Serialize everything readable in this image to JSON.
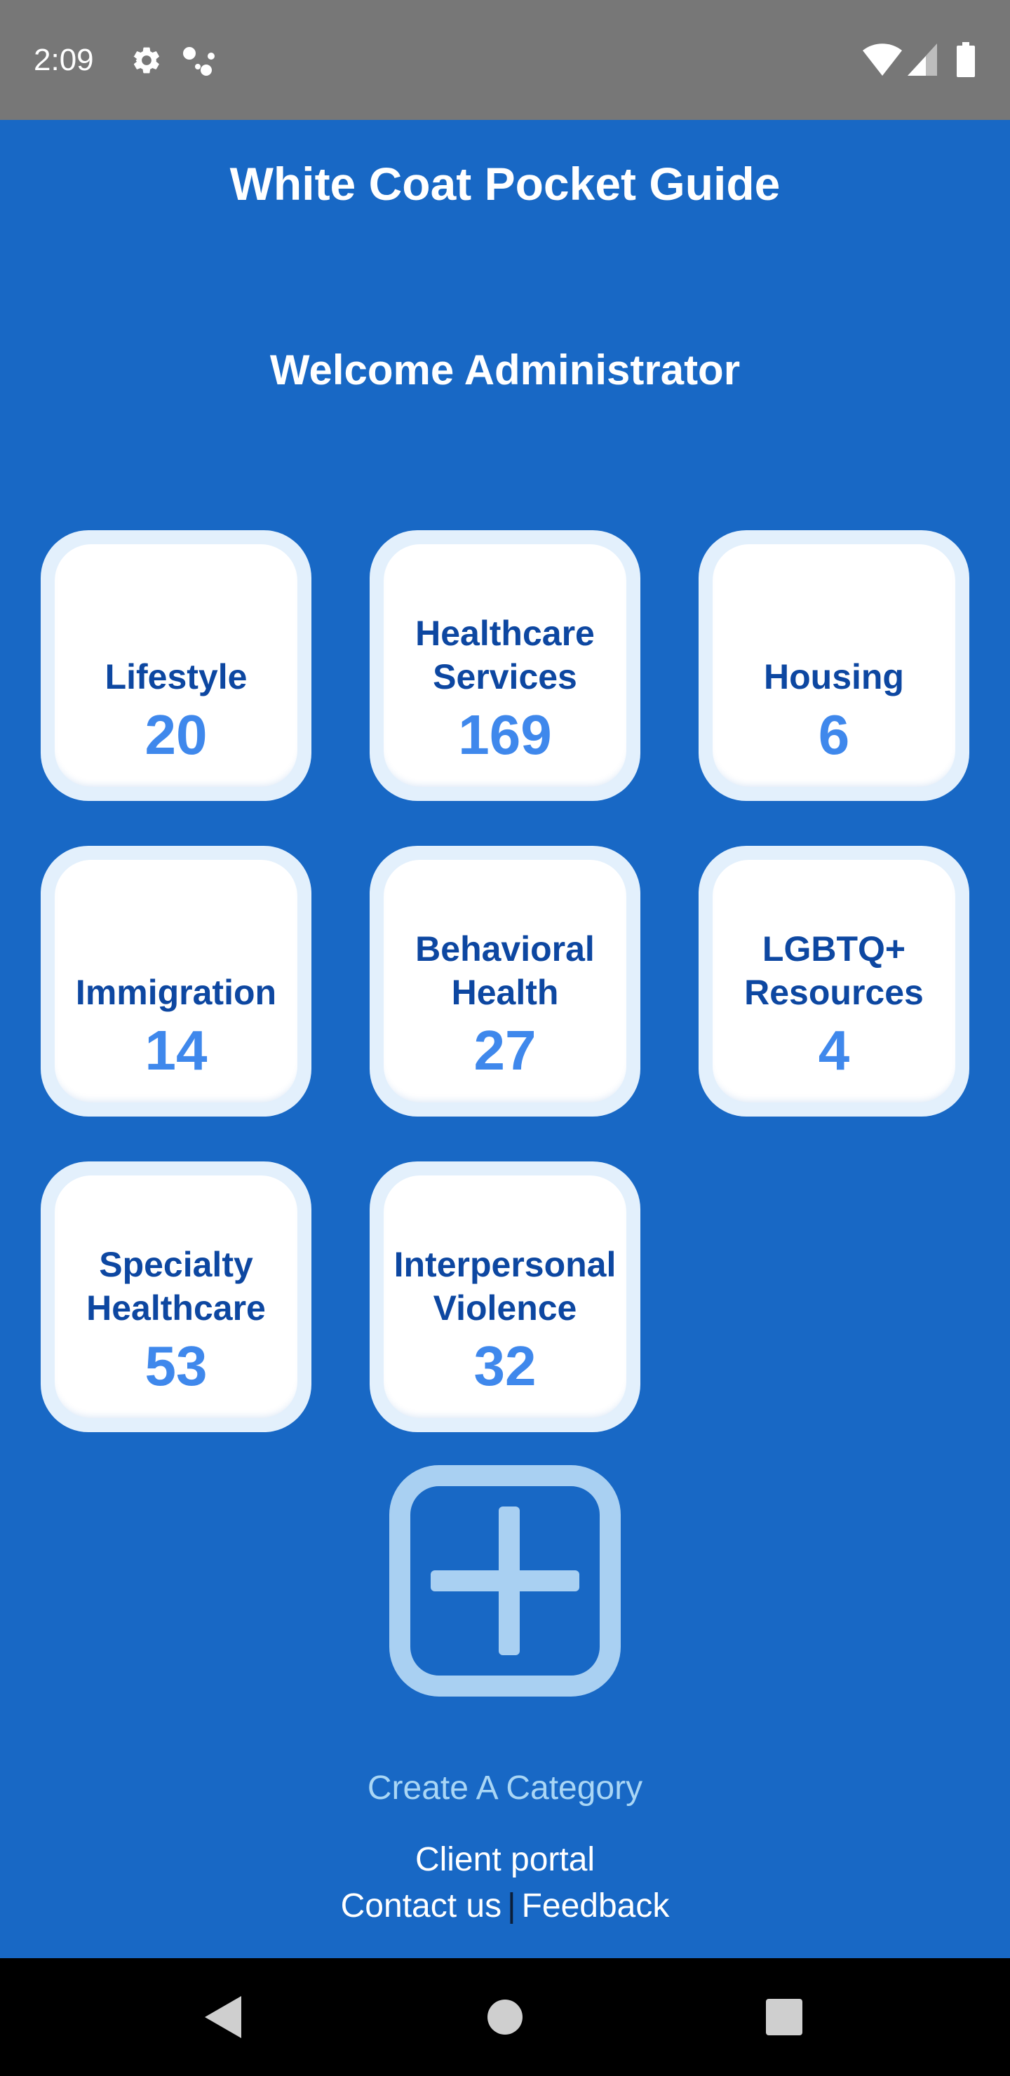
{
  "status_bar": {
    "time": "2:09",
    "icons": [
      "gear-icon",
      "assistant-dots-icon",
      "wifi-icon",
      "cell-signal-icon",
      "battery-icon"
    ]
  },
  "header": {
    "title": "White Coat Pocket Guide",
    "welcome": "Welcome Administrator"
  },
  "categories": [
    {
      "label": "Lifestyle",
      "count": "20"
    },
    {
      "label": "Healthcare Services",
      "count": "169"
    },
    {
      "label": "Housing",
      "count": "6"
    },
    {
      "label": "Immigration",
      "count": "14"
    },
    {
      "label": "Behavioral Health",
      "count": "27"
    },
    {
      "label": "LGBTQ+ Resources",
      "count": "4"
    },
    {
      "label": "Specialty Healthcare",
      "count": "53"
    },
    {
      "label": "Interpersonal Violence",
      "count": "32"
    }
  ],
  "create_category": {
    "icon": "plus-square-icon",
    "label": "Create A Category"
  },
  "footer": {
    "client_portal": "Client portal",
    "contact_us": "Contact us",
    "separator": "|",
    "feedback": "Feedback"
  },
  "nav_bar": {
    "icons": [
      "back-icon",
      "home-icon",
      "recents-icon"
    ]
  },
  "colors": {
    "background": "#1868c5",
    "status_bar": "#777777",
    "tile_border": "#e3f0fc",
    "tile_label": "#0d47a1",
    "tile_count": "#3f88ec",
    "create_label": "#a9d6f5",
    "add_icon": "#a9d0f2"
  }
}
